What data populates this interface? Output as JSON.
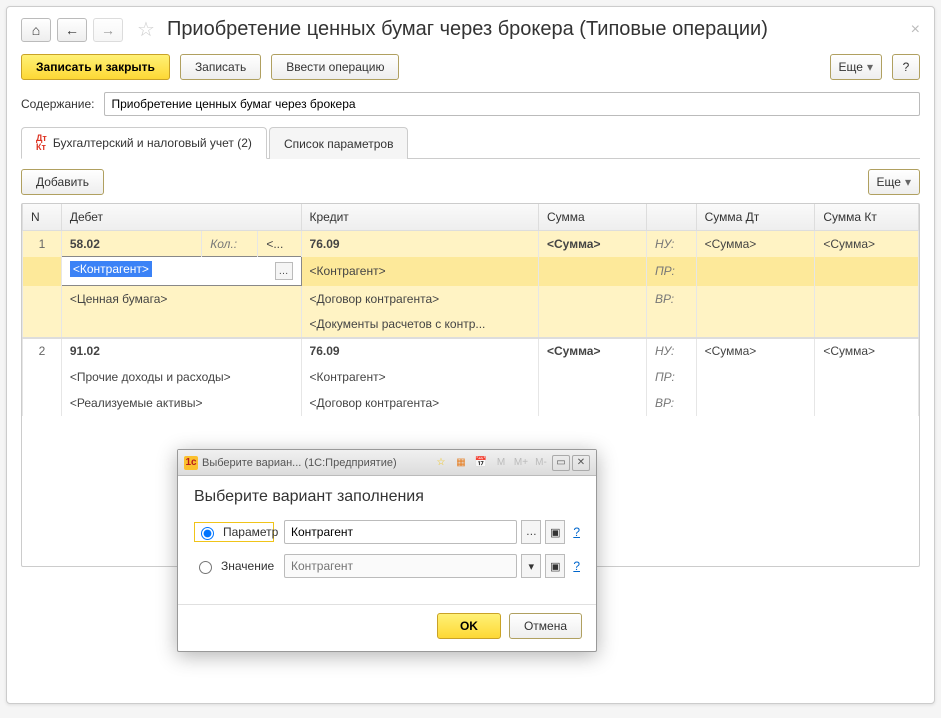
{
  "header": {
    "title": "Приобретение ценных бумаг через брокера (Типовые операции)"
  },
  "toolbar": {
    "save_close": "Записать и закрыть",
    "save": "Записать",
    "enter_op": "Ввести операцию",
    "more": "Еще",
    "help": "?"
  },
  "content_field": {
    "label": "Содержание:",
    "value": "Приобретение ценных бумаг через брокера"
  },
  "tabs": [
    {
      "label": "Бухгалтерский и налоговый учет (2)",
      "active": true
    },
    {
      "label": "Список параметров",
      "active": false
    }
  ],
  "subtoolbar": {
    "add": "Добавить",
    "more": "Еще"
  },
  "table": {
    "columns": {
      "n": "N",
      "debit": "Дебет",
      "credit": "Кредит",
      "sum": "Сумма",
      "sum_dt": "Сумма Дт",
      "sum_kt": "Сумма Кт"
    },
    "row1": {
      "n": "1",
      "debit_acc": "58.02",
      "debit_qty_label": "Кол.:",
      "debit_qty_val": "<...",
      "credit_acc": "76.09",
      "sum": "<Сумма>",
      "nu": "НУ:",
      "sum_dt": "<Сумма>",
      "sum_kt": "<Сумма>",
      "debit_sub1": "<Контрагент>",
      "credit_sub1": "<Контрагент>",
      "pr": "ПР:",
      "debit_sub2": "<Ценная бумага>",
      "credit_sub2": "<Договор контрагента>",
      "vr": "ВР:",
      "credit_sub3": "<Документы расчетов с контр..."
    },
    "row2": {
      "n": "2",
      "debit_acc": "91.02",
      "credit_acc": "76.09",
      "sum": "<Сумма>",
      "nu": "НУ:",
      "sum_dt": "<Сумма>",
      "sum_kt": "<Сумма>",
      "debit_sub1": "<Прочие доходы и расходы>",
      "credit_sub1": "<Контрагент>",
      "pr": "ПР:",
      "debit_sub2": "<Реализуемые активы>",
      "credit_sub2": "<Договор контрагента>",
      "vr": "ВР:"
    }
  },
  "modal": {
    "win_title": "Выберите вариан...   (1С:Предприятие)",
    "title": "Выберите вариант заполнения",
    "opt_param": "Параметр",
    "opt_value": "Значение",
    "param_value": "Контрагент",
    "value_placeholder": "Контрагент",
    "ok": "OK",
    "cancel": "Отмена",
    "icons_right": [
      "☆",
      "▦",
      "📅",
      "M",
      "M+",
      "M-"
    ]
  }
}
